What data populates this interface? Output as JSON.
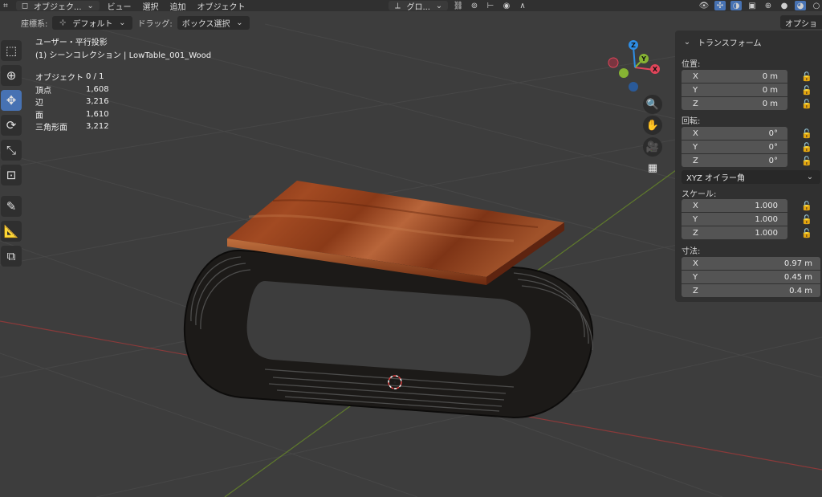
{
  "header": {
    "mode_label": "オブジェク...",
    "menu": [
      "ビュー",
      "選択",
      "追加",
      "オブジェクト"
    ],
    "orientation_label": "グロ..."
  },
  "tool_settings": {
    "coord_label": "座標系:",
    "coord_value": "デフォルト",
    "drag_label": "ドラッグ:",
    "drag_value": "ボックス選択",
    "options_label": "オプショ"
  },
  "viewport": {
    "view_name": "ユーザー・平行投影",
    "collection_line": "(1) シーンコレクション | LowTable_001_Wood",
    "stats": [
      {
        "label": "オブジェクト",
        "value": "0 / 1"
      },
      {
        "label": "頂点",
        "value": "1,608"
      },
      {
        "label": "辺",
        "value": "3,216"
      },
      {
        "label": "面",
        "value": "1,610"
      },
      {
        "label": "三角形面",
        "value": "3,212"
      }
    ],
    "gizmo": {
      "x": "X",
      "y": "Y",
      "z": "Z",
      "x_color": "#e2455a",
      "y_color": "#86b333",
      "z_color": "#2e8ee6"
    }
  },
  "npanel": {
    "title": "トランスフォーム",
    "location_label": "位置:",
    "location": [
      {
        "axis": "X",
        "value": "0 m"
      },
      {
        "axis": "Y",
        "value": "0 m"
      },
      {
        "axis": "Z",
        "value": "0 m"
      }
    ],
    "rotation_label": "回転:",
    "rotation": [
      {
        "axis": "X",
        "value": "0°"
      },
      {
        "axis": "Y",
        "value": "0°"
      },
      {
        "axis": "Z",
        "value": "0°"
      }
    ],
    "rotation_mode": "XYZ オイラー角",
    "scale_label": "スケール:",
    "scale": [
      {
        "axis": "X",
        "value": "1.000"
      },
      {
        "axis": "Y",
        "value": "1.000"
      },
      {
        "axis": "Z",
        "value": "1.000"
      }
    ],
    "dimensions_label": "寸法:",
    "dimensions": [
      {
        "axis": "X",
        "value": "0.97 m"
      },
      {
        "axis": "Y",
        "value": "0.45 m"
      },
      {
        "axis": "Z",
        "value": "0.4 m"
      }
    ]
  },
  "colors": {
    "accent": "#4772b3",
    "bg": "#3d3d3d",
    "panel": "#303030"
  }
}
